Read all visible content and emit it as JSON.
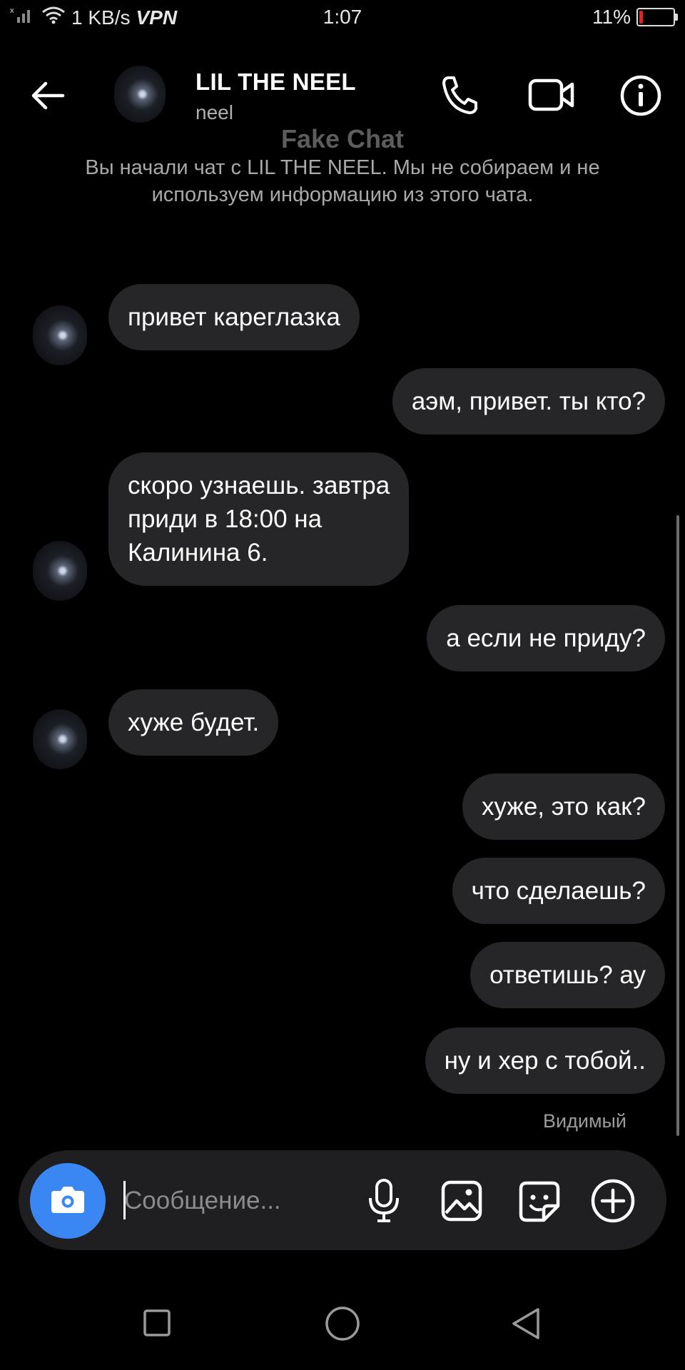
{
  "status_bar": {
    "speed": "1 KB/s",
    "vpn": "VPN",
    "time": "1:07",
    "battery_percent": "11%",
    "battery_level": 0.11,
    "battery_color": "#e22222"
  },
  "header": {
    "title": "LIL THE NEEL",
    "subtitle": "neel",
    "icons": [
      "back-arrow-icon",
      "phone-icon",
      "video-camera-icon",
      "info-icon"
    ]
  },
  "chat": {
    "banner": "Fake Chat",
    "intro": "Вы начали чат с LIL THE NEEL. Мы не собираем и не используем информацию из этого чата.",
    "messages": [
      {
        "side": "received",
        "text": "привет кареглазка"
      },
      {
        "side": "sent",
        "text": "аэм, привет. ты кто?"
      },
      {
        "side": "received",
        "text": "скоро узнаешь. завтра\nприди в 18:00 на\nКалинина 6."
      },
      {
        "side": "sent",
        "text": "а если не приду?"
      },
      {
        "side": "received",
        "text": "хуже будет."
      },
      {
        "side": "sent",
        "text": "хуже, это как?"
      },
      {
        "side": "sent",
        "text": "что сделаешь?"
      },
      {
        "side": "sent",
        "text": "ответишь? ау"
      },
      {
        "side": "sent",
        "text": "ну и хер с тобой.."
      }
    ],
    "seen_label": "Видимый",
    "bubble_color": "#262628"
  },
  "composer": {
    "placeholder": "Сообщение...",
    "value": "",
    "accent": "#3a86f3",
    "icons": [
      "camera-icon",
      "microphone-icon",
      "image-icon",
      "sticker-icon",
      "plus-icon"
    ]
  },
  "nav_bar": {
    "icons": [
      "recents-square-icon",
      "home-circle-icon",
      "back-triangle-icon"
    ]
  }
}
